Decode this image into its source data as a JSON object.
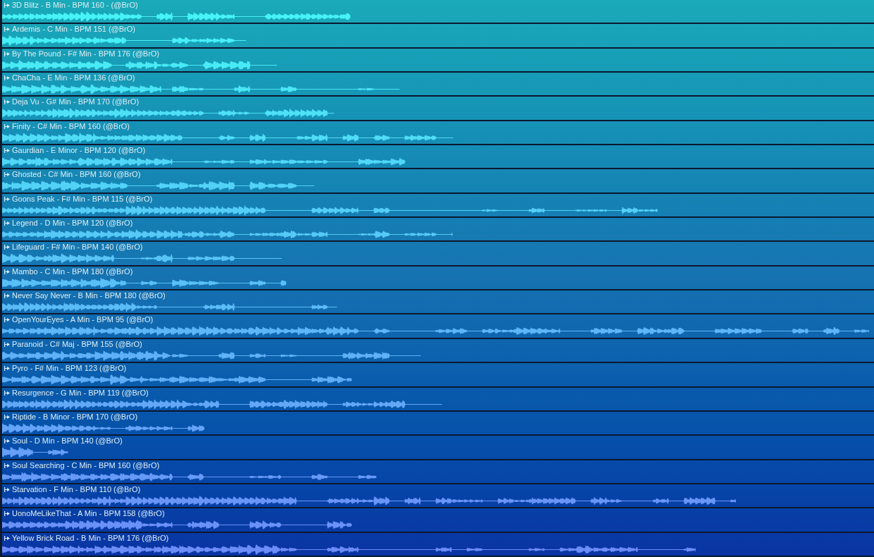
{
  "clips": [
    {
      "title": "3D Blitz - B Min - BPM 160 - (@BrO)"
    },
    {
      "title": "Ardemis - C Min - BPM 151 (@BrO)"
    },
    {
      "title": "By The Pound - F# Min - BPM 176 (@BrO)"
    },
    {
      "title": "ChaCha - E Min - BPM 136 (@BrO)"
    },
    {
      "title": "Deja Vu - G# Min - BPM 170 (@BrO)"
    },
    {
      "title": "Finity - C# Min - BPM 160 (@BrO)"
    },
    {
      "title": "Gaurdian - E Minor - BPM 120 (@BrO)"
    },
    {
      "title": "Ghosted - C# Min - BPM 160 (@BrO)"
    },
    {
      "title": "Goons Peak - F# Min - BPM 115 (@BrO)"
    },
    {
      "title": "Legend - D Min - BPM 120 (@BrO)"
    },
    {
      "title": "Lifeguard - F# Min - BPM 140 (@BrO)"
    },
    {
      "title": "Mambo - C Min - BPM 180 (@BrO)"
    },
    {
      "title": "Never Say Never - B Min - BPM 180 (@BrO)"
    },
    {
      "title": "OpenYourEyes - A Min - BPM 95 (@BrO)"
    },
    {
      "title": "Paranoid - C# Maj - BPM 155 (@BrO)"
    },
    {
      "title": "Pyro - F# Min - BPM 123 (@BrO)"
    },
    {
      "title": "Resurgence - G Min - BPM 119 (@BrO)"
    },
    {
      "title": "Riptide - B Minor - BPM 170 (@BrO)"
    },
    {
      "title": "Soul - D Min - BPM 140 (@BrO)"
    },
    {
      "title": "Soul Searching - C Min - BPM 160 (@BrO)"
    },
    {
      "title": "Starvation - F Min - BPM 110 (@BrO)"
    },
    {
      "title": "UonoMeLikeThat - A Min - BPM 158 (@BrO)"
    },
    {
      "title": "Yellow Brick Road - B Min - BPM 176 (@BrO)"
    }
  ]
}
